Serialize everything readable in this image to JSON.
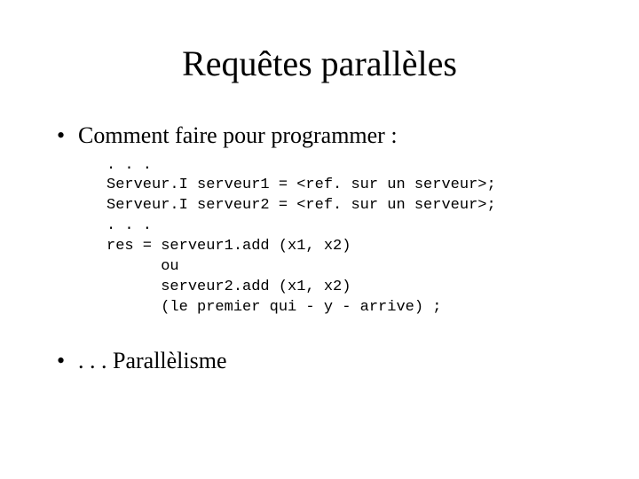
{
  "title": "Requêtes parallèles",
  "bullet1": "Comment faire pour programmer :",
  "code": {
    "l1": ". . .",
    "l2": "Serveur.I serveur1 = <ref. sur un serveur>;",
    "l3": "Serveur.I serveur2 = <ref. sur un serveur>;",
    "l4": ". . .",
    "l5": "res = serveur1.add (x1, x2)",
    "l6": "      ou",
    "l7": "      serveur2.add (x1, x2)",
    "l8": "      (le premier qui - y - arrive) ;"
  },
  "bullet2": ". . . Parallèlisme"
}
